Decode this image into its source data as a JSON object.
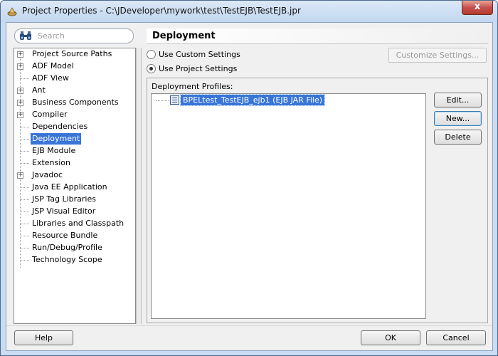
{
  "window": {
    "title": "Project Properties - C:\\JDeveloper\\mywork\\test\\TestEJB\\TestEJB.jpr",
    "close_label": "x"
  },
  "search": {
    "placeholder": "Search"
  },
  "tree": {
    "items": [
      {
        "label": "Project Source Paths",
        "expandable": true
      },
      {
        "label": "ADF Model",
        "expandable": true
      },
      {
        "label": "ADF View",
        "expandable": false
      },
      {
        "label": "Ant",
        "expandable": true
      },
      {
        "label": "Business Components",
        "expandable": true
      },
      {
        "label": "Compiler",
        "expandable": true
      },
      {
        "label": "Dependencies",
        "expandable": false
      },
      {
        "label": "Deployment",
        "expandable": false,
        "selected": true
      },
      {
        "label": "EJB Module",
        "expandable": false
      },
      {
        "label": "Extension",
        "expandable": false
      },
      {
        "label": "Javadoc",
        "expandable": true
      },
      {
        "label": "Java EE Application",
        "expandable": false
      },
      {
        "label": "JSP Tag Libraries",
        "expandable": false
      },
      {
        "label": "JSP Visual Editor",
        "expandable": false
      },
      {
        "label": "Libraries and Classpath",
        "expandable": false
      },
      {
        "label": "Resource Bundle",
        "expandable": false
      },
      {
        "label": "Run/Debug/Profile",
        "expandable": false
      },
      {
        "label": "Technology Scope",
        "expandable": false
      }
    ]
  },
  "main": {
    "heading": "Deployment",
    "radio_custom": "Use Custom Settings",
    "radio_project": "Use Project Settings",
    "customize_button": "Customize Settings...",
    "profiles_label": "Deployment Profiles:",
    "profiles": [
      "BPELtest_TestEJB_ejb1 (EJB JAR File)"
    ],
    "edit_button": "Edit...",
    "new_button": "New...",
    "delete_button": "Delete"
  },
  "footer": {
    "help_button": "Help",
    "ok_button": "OK",
    "cancel_button": "Cancel"
  },
  "colors": {
    "selection": "#3875d7",
    "window_frame": "#c9dcf2",
    "close_button": "#c75050"
  }
}
